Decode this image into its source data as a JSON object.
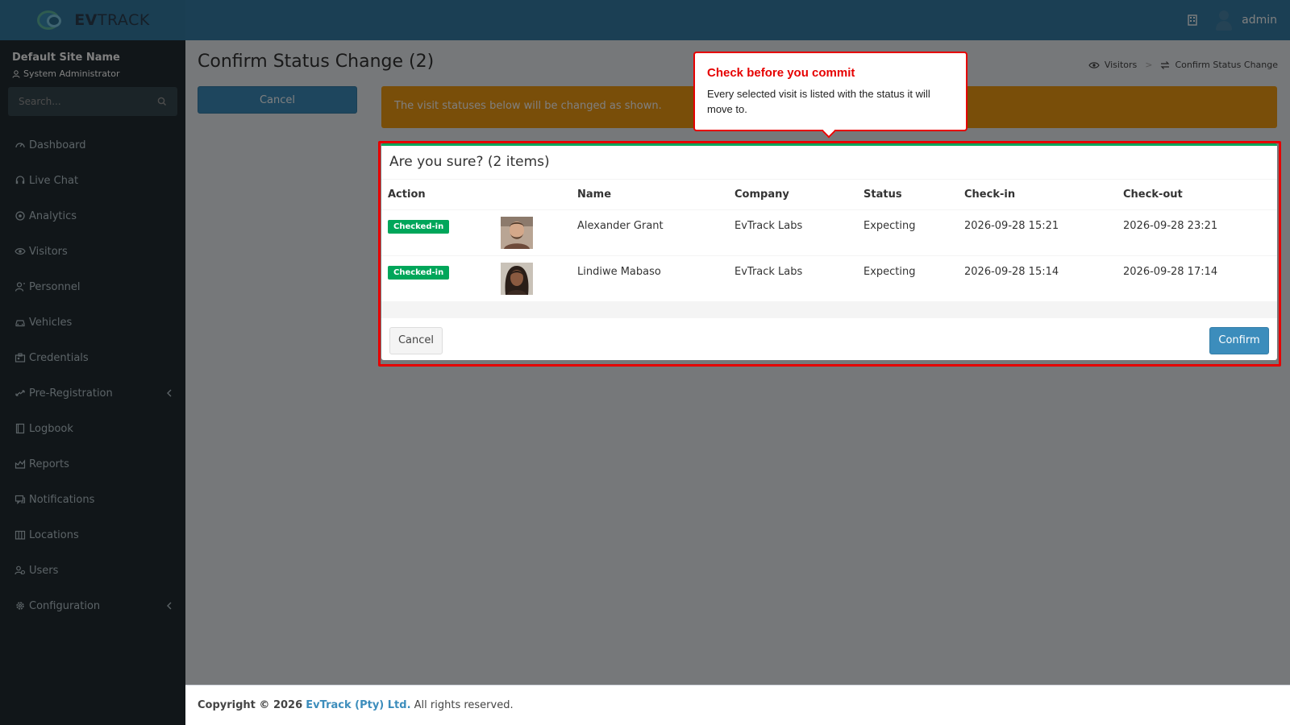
{
  "brand": {
    "name_bold": "EV",
    "name_rest": "TRACK"
  },
  "header": {
    "user": "admin",
    "building_icon": "building-icon",
    "avatar_icon": "user-avatar-icon"
  },
  "sidebar": {
    "site_name": "Default Site Name",
    "role": "System Administrator",
    "search_placeholder": "Search...",
    "items": [
      {
        "label": "Dashboard",
        "icon": "dashboard-icon"
      },
      {
        "label": "Live Chat",
        "icon": "headset-icon"
      },
      {
        "label": "Analytics",
        "icon": "target-icon"
      },
      {
        "label": "Visitors",
        "icon": "eye-icon"
      },
      {
        "label": "Personnel",
        "icon": "person-icon"
      },
      {
        "label": "Vehicles",
        "icon": "car-icon"
      },
      {
        "label": "Credentials",
        "icon": "id-card-icon"
      },
      {
        "label": "Pre-Registration",
        "icon": "exchange-icon",
        "expandable": true
      },
      {
        "label": "Logbook",
        "icon": "book-icon"
      },
      {
        "label": "Reports",
        "icon": "chart-icon"
      },
      {
        "label": "Notifications",
        "icon": "comment-icon"
      },
      {
        "label": "Locations",
        "icon": "map-icon"
      },
      {
        "label": "Users",
        "icon": "users-icon"
      },
      {
        "label": "Configuration",
        "icon": "gear-icon",
        "expandable": true
      }
    ]
  },
  "page": {
    "title": "Confirm Status Change (2)",
    "breadcrumb": [
      "Visitors",
      "Confirm Status Change"
    ],
    "cancel_label": "Cancel",
    "warning": "The visit statuses below will be changed as shown."
  },
  "modal": {
    "title": "Are you sure? (2 items)",
    "columns": [
      "Action",
      "",
      "Name",
      "Company",
      "Status",
      "Check-in",
      "Check-out"
    ],
    "rows": [
      {
        "action": "Checked-in",
        "name": "Alexander Grant",
        "company": "EvTrack Labs",
        "status": "Expecting",
        "checkin": "2026-09-28 15:21",
        "checkout": "2026-09-28 23:21"
      },
      {
        "action": "Checked-in",
        "name": "Lindiwe Mabaso",
        "company": "EvTrack Labs",
        "status": "Expecting",
        "checkin": "2026-09-28 15:14",
        "checkout": "2026-09-28 17:14"
      }
    ],
    "cancel_label": "Cancel",
    "confirm_label": "Confirm"
  },
  "tooltip": {
    "title": "Check before you commit",
    "body": "Every selected visit is listed with the status it will move to."
  },
  "footer": {
    "prefix": "Copyright © 2026",
    "company": "EvTrack (Pty) Ltd.",
    "suffix": "All rights reserved."
  },
  "colors": {
    "header": "#367fa9",
    "sidebar": "#222d32",
    "accent": "#3c8dbc",
    "success": "#00a65a",
    "warning": "#f39c12",
    "highlight": "#e60000"
  }
}
